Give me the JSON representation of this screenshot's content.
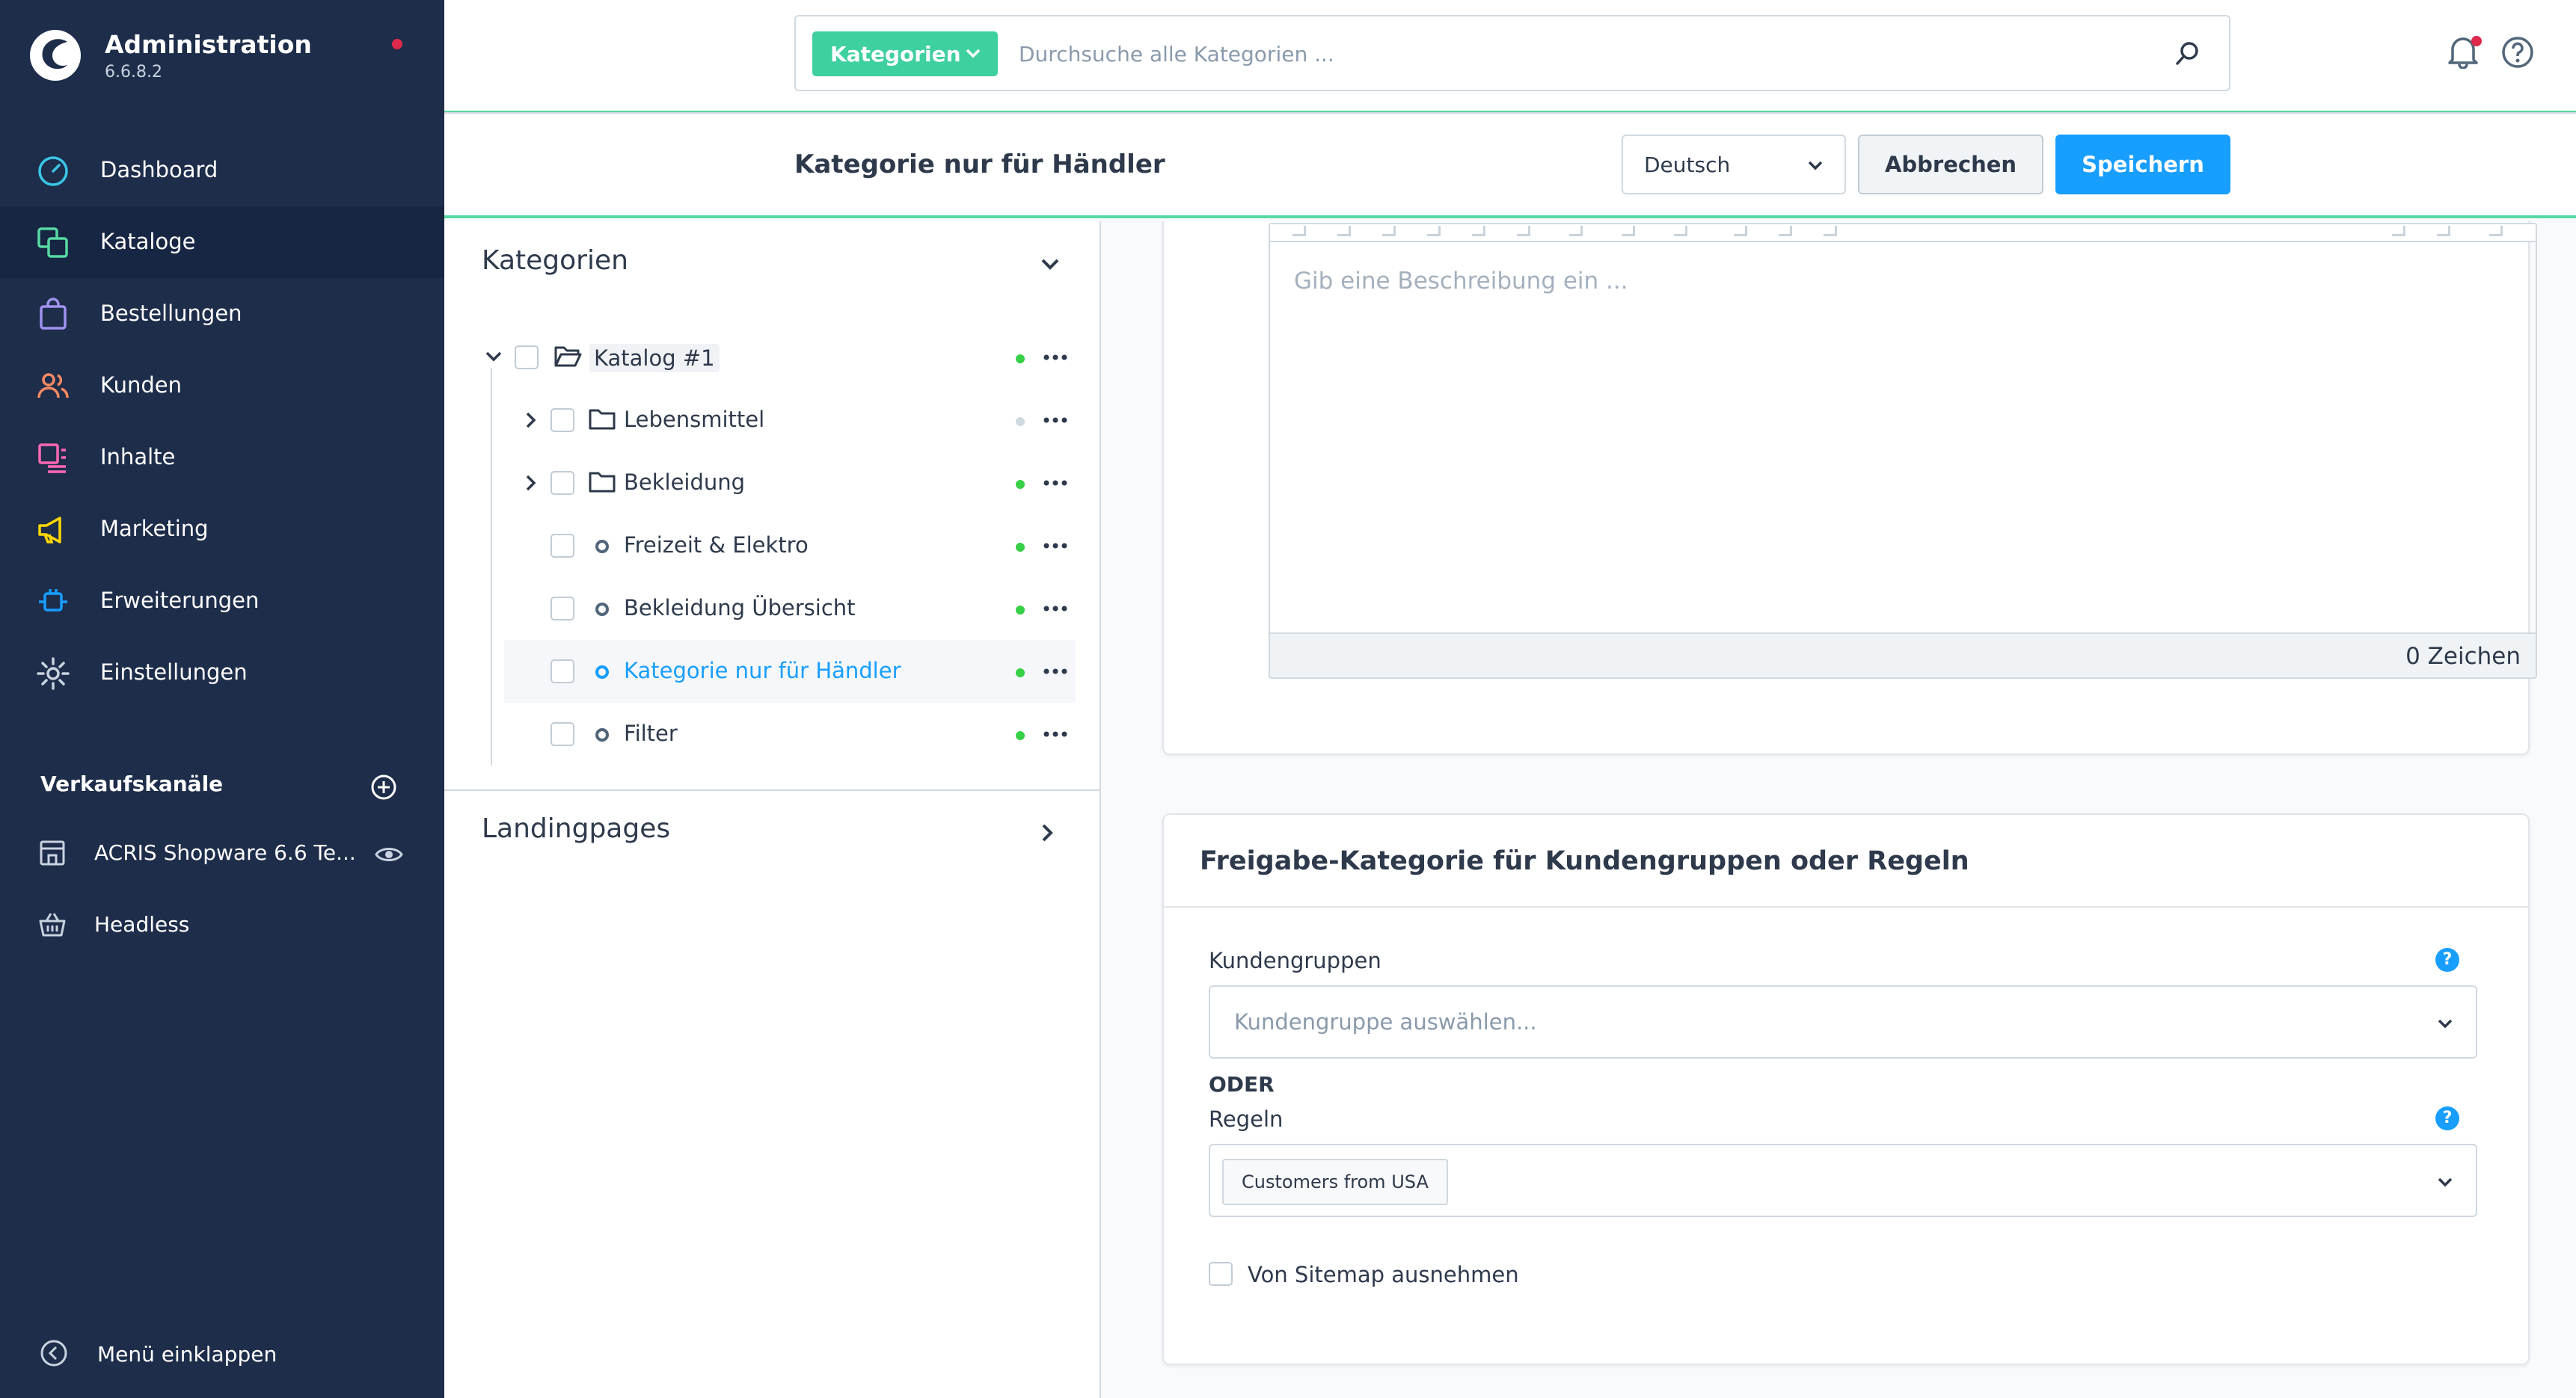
{
  "app": {
    "title": "Administration",
    "version": "6.6.8.2"
  },
  "nav": [
    {
      "label": "Dashboard",
      "icon": "dashboard-icon"
    },
    {
      "label": "Kataloge",
      "icon": "catalog-icon"
    },
    {
      "label": "Bestellungen",
      "icon": "shopping-bag-icon"
    },
    {
      "label": "Kunden",
      "icon": "users-icon"
    },
    {
      "label": "Inhalte",
      "icon": "content-icon"
    },
    {
      "label": "Marketing",
      "icon": "megaphone-icon"
    },
    {
      "label": "Erweiterungen",
      "icon": "plug-icon"
    },
    {
      "label": "Einstellungen",
      "icon": "gear-icon"
    }
  ],
  "sales_channels": {
    "heading": "Verkaufskanäle",
    "items": [
      {
        "label": "ACRIS Shopware 6.6 Te...",
        "icon": "storefront-icon"
      },
      {
        "label": "Headless",
        "icon": "basket-icon"
      }
    ]
  },
  "sidebar_footer": {
    "collapse_label": "Menü einklappen"
  },
  "search": {
    "type_label": "Kategorien",
    "placeholder": "Durchsuche alle Kategorien ..."
  },
  "header": {
    "title": "Kategorie nur für Händler",
    "language": "Deutsch",
    "cancel_label": "Abbrechen",
    "save_label": "Speichern"
  },
  "tree": {
    "heading": "Kategorien",
    "root": "Katalog #1",
    "items": [
      {
        "label": "Lebensmittel",
        "type": "folder",
        "active": false
      },
      {
        "label": "Bekleidung",
        "type": "folder",
        "active": true
      },
      {
        "label": "Freizeit & Elektro",
        "type": "leaf",
        "active": true
      },
      {
        "label": "Bekleidung Übersicht",
        "type": "leaf",
        "active": true
      },
      {
        "label": "Kategorie nur für Händler",
        "type": "leaf",
        "active": true,
        "selected": true
      },
      {
        "label": "Filter",
        "type": "leaf",
        "active": true
      }
    ],
    "landing_heading": "Landingpages"
  },
  "description": {
    "placeholder": "Gib eine Beschreibung ein ...",
    "char_count": "0 Zeichen"
  },
  "release": {
    "title": "Freigabe-Kategorie für Kundengruppen oder Regeln",
    "customer_groups_label": "Kundengruppen",
    "customer_groups_placeholder": "Kundengruppe auswählen...",
    "or_label": "ODER",
    "rules_label": "Regeln",
    "rule_tag": "Customers from USA",
    "sitemap_label": "Von Sitemap ausnehmen",
    "help_glyph": "?"
  },
  "colors": {
    "sidebar": "#1d2d4a",
    "accent": "#189eff",
    "green": "#3fd0a0",
    "status_active": "#37d046"
  }
}
